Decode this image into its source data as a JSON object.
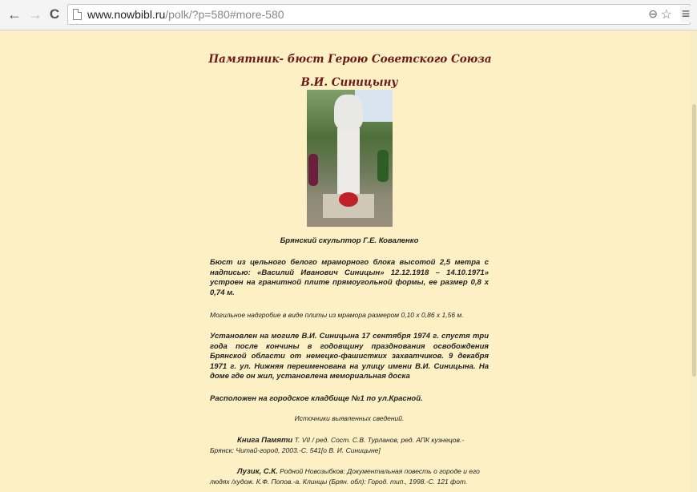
{
  "browser": {
    "url_domain": "www.nowbibl.ru",
    "url_path": "/polk/?p=580#more-580",
    "back_icon": "arrow-left-icon",
    "forward_icon": "arrow-right-icon",
    "reload_icon": "reload-icon",
    "zoom_icon": "zoom-icon",
    "star_icon": "star-icon",
    "menu_icon": "menu-icon"
  },
  "article": {
    "title_line1": "Памятник- бюст Герою Советского Союза",
    "title_line2": "В.И. Синицыну",
    "photo_caption": "Брянский скульптор Г.Е. Коваленко",
    "para1": "Бюст из цельного белого мраморного блока высотой 2,5 метра с надписью: «Василий Иванович Синицын» 12.12.1918 – 14.10.1971» устроен на гранитной плите прямоугольной формы, ее размер 0,8 х 0,74 м.",
    "para2": "Могильное надгробие в виде плиты из мрамора размером 0,10 х 0,86 х 1,56 м.",
    "para3": "Установлен на могиле В.И. Синицына 17 сентября 1974 г. спустя три года после кончины в годовщину празднования освобождения Брянской области от немецко-фашистких захватчиков. 9 декабря 1971 г. ул. Нижняя переименована на улицу имени В.И. Синицына. На доме где он жил, установлена мемориальная доска",
    "para4": "Расположен на городское кладбище №1 по ул.Красной.",
    "sources_heading": "Источники выявленных сведений.",
    "ref1_bold": "Книга Памяти",
    "ref1_text": " Т. VII / ред. Сост. С.В. Турланов, ред. АПК кузнецов.- Брянск: Читай-город, 2003.-С. 541[о В. И. Синицыне]",
    "ref2_bold": "Лузик, С.К.",
    "ref2_text": " Родной Новозыбков: Документальная повесть о городе и его людях /худож. К.Ф. Попов.-а. Клинцы (Брян. обл): Город. тип., 1998.-С. 121 фот."
  }
}
